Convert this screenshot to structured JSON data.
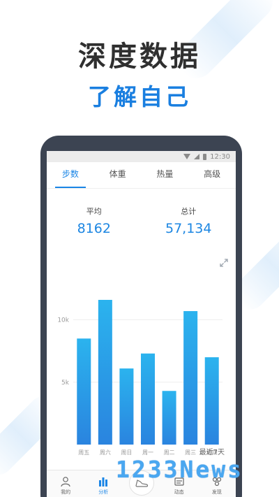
{
  "headline": "深度数据",
  "subhead": "了解自己",
  "status_bar": {
    "time": "12:30"
  },
  "tabs": [
    {
      "label": "步数",
      "active": true
    },
    {
      "label": "体重",
      "active": false
    },
    {
      "label": "热量",
      "active": false
    },
    {
      "label": "高级",
      "active": false
    }
  ],
  "stats": {
    "average": {
      "label": "平均",
      "value": "8162"
    },
    "total": {
      "label": "总计",
      "value": "57,134"
    }
  },
  "chart_data": {
    "type": "bar",
    "categories": [
      "周五",
      "周六",
      "周日",
      "周一",
      "周二",
      "周三",
      "周四"
    ],
    "values": [
      8500,
      11600,
      6100,
      7300,
      4300,
      10700,
      7000
    ],
    "y_ticks": [
      "5k",
      "10k"
    ],
    "y_tick_values": [
      5000,
      10000
    ],
    "ylim": [
      0,
      13000
    ],
    "footer_label": "最近7天",
    "bar_color_top": "#2bb3ee",
    "bar_color_bottom": "#2a84df"
  },
  "bottom_nav": [
    {
      "label": "我的",
      "icon": "person-icon",
      "active": false
    },
    {
      "label": "分析",
      "icon": "bar-chart-icon",
      "active": true
    },
    {
      "label": "",
      "icon": "shoe-icon",
      "active": false
    },
    {
      "label": "动态",
      "icon": "feed-icon",
      "active": false
    },
    {
      "label": "发现",
      "icon": "discover-icon",
      "active": false
    }
  ],
  "watermark": "1233News",
  "colors": {
    "accent": "#1a85e6",
    "phone_frame": "#3c4452"
  }
}
